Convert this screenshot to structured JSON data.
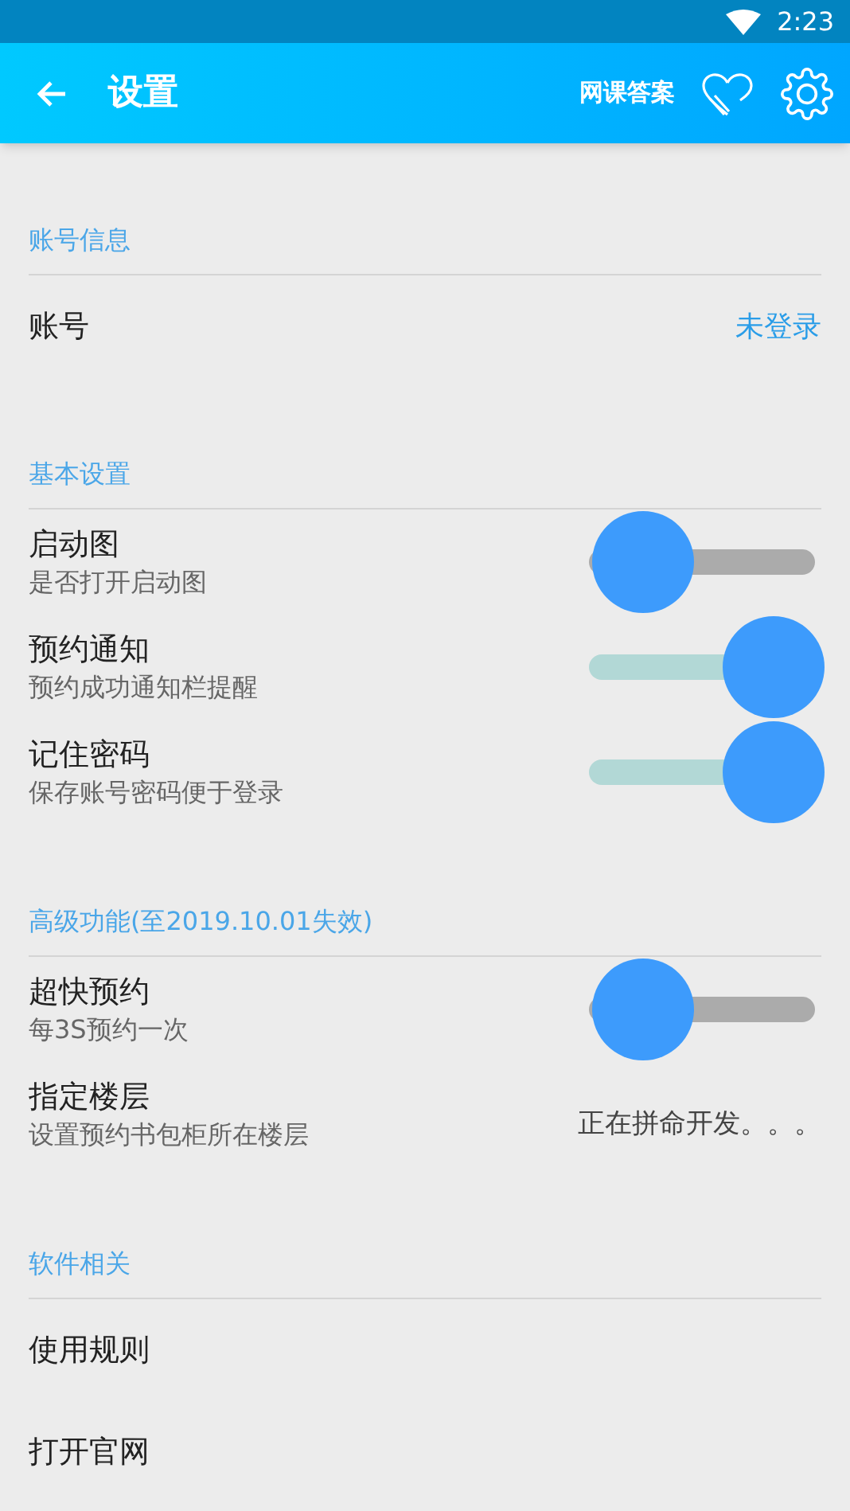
{
  "status_bar": {
    "time": "2:23"
  },
  "app_bar": {
    "title": "设置",
    "action": "网课答案"
  },
  "sections": [
    {
      "title": "账号信息",
      "items": [
        {
          "kind": "value",
          "label": "账号",
          "value": "未登录"
        }
      ]
    },
    {
      "title": "基本设置",
      "items": [
        {
          "kind": "switch",
          "label": "启动图",
          "subtitle": "是否打开启动图",
          "on": false
        },
        {
          "kind": "switch",
          "label": "预约通知",
          "subtitle": "预约成功通知栏提醒",
          "on": true
        },
        {
          "kind": "switch",
          "label": "记住密码",
          "subtitle": "保存账号密码便于登录",
          "on": true
        }
      ]
    },
    {
      "title": "高级功能(至2019.10.01失效)",
      "items": [
        {
          "kind": "switch",
          "label": "超快预约",
          "subtitle": "每3S预约一次",
          "on": false
        },
        {
          "kind": "text",
          "label": "指定楼层",
          "subtitle": "设置预约书包柜所在楼层",
          "value": "正在拼命开发。。。"
        }
      ]
    },
    {
      "title": "软件相关",
      "items": [
        {
          "kind": "plain",
          "label": "使用规则"
        },
        {
          "kind": "plain",
          "label": "打开官网"
        }
      ]
    }
  ]
}
